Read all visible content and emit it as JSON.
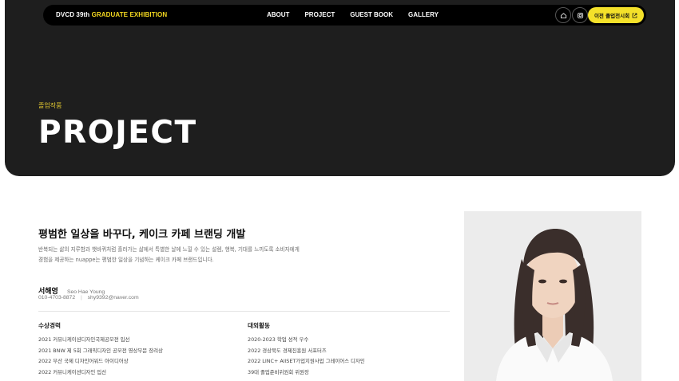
{
  "nav": {
    "brand_prefix": "DVCD 39th",
    "brand_accent": "GRADUATE EXHIBITION",
    "links": [
      "ABOUT",
      "PROJECT",
      "GUEST BOOK",
      "GALLERY"
    ],
    "home_icon": "home-icon",
    "instagram_icon": "instagram-icon",
    "prev_button": "이전 졸업전시회",
    "external_icon": "external-link-icon"
  },
  "hero": {
    "eyebrow": "졸업작품",
    "title": "PROJECT"
  },
  "project": {
    "title": "평범한 일상을 바꾸다, 케이크 카페 브랜딩 개발",
    "description_line1": "반복되는 삶의 지루함과 햇바퀴처럼 흘러가는 삶에서 특별한 날에 느낄 수 있는 설렘, 행복, 기대를 느끼도록 소비자에게",
    "description_line2": "경험을 제공하는 nuappe는 평범한 일상을 기념하는 케이크 카페 브랜드입니다."
  },
  "designer": {
    "name_kr": "서해영",
    "name_en": "Seo Hae Young",
    "phone": "010-4703-8872",
    "separator": "|",
    "email": "shy9392@naver.com"
  },
  "awards": {
    "heading": "수상경력",
    "items": [
      "2021 커뮤니케이션디자인국제공모전 입선",
      "2021 BNW 제 5회 그래픽디자인 공모전 영상부문 장려상",
      "2022 부산 국제 디자인어워드 아이디어상",
      "2022 커뮤니케이션디자인 입선"
    ]
  },
  "activities": {
    "heading": "대외활동",
    "items": [
      "2020-2023 학업 성적 우수",
      "2022 경상북도 경제진흥원 서포터즈",
      "2022 LINC+ AllSET가업지원사업 그레이어스 디자인",
      "39대 졸업준비위원회 위원장"
    ]
  },
  "colors": {
    "hero_bg": "#1e1e1e",
    "accent_yellow": "#f4e12a",
    "eyebrow": "#e1c730"
  }
}
